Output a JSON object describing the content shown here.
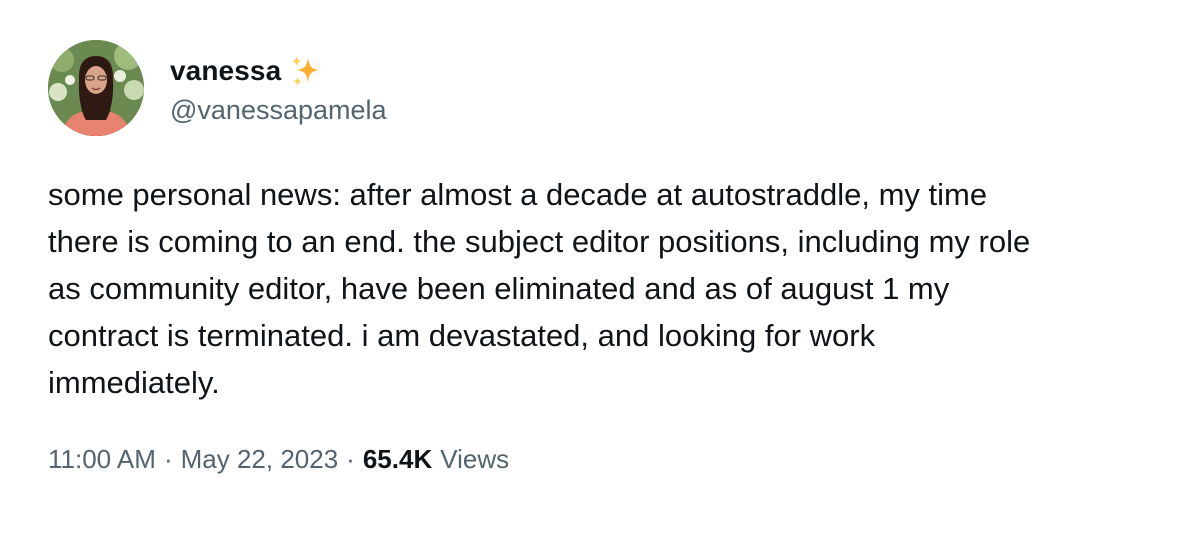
{
  "author": {
    "display_name": "vanessa",
    "handle": "@vanessapamela",
    "name_emoji_icon": "sparkles-icon",
    "avatar_icon": "profile-photo"
  },
  "tweet": {
    "text": "some personal news: after almost a decade at autostraddle, my time\nthere is coming to an end. the subject editor positions, including my role\nas community editor, have been eliminated and as of august 1 my\ncontract is terminated. i am devastated, and looking for work\nimmediately."
  },
  "meta": {
    "time": "11:00 AM",
    "separator": "·",
    "date": "May 22, 2023",
    "views_count": "65.4K",
    "views_label": "Views"
  },
  "colors": {
    "text_primary": "#0f1419",
    "text_secondary": "#536471",
    "sparkle": "#ffac33",
    "background": "#ffffff"
  }
}
